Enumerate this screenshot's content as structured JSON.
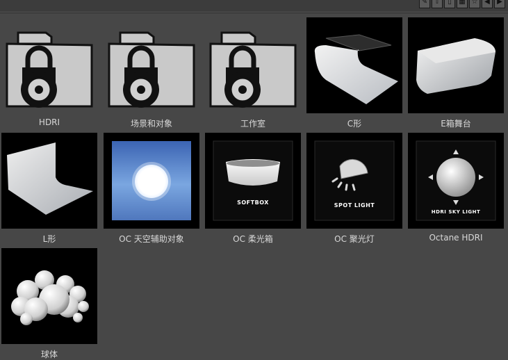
{
  "toolbar": {
    "icons": [
      "edit-icon",
      "upload-icon",
      "clip-icon",
      "grid-icon",
      "star-icon",
      "arrow-left-icon",
      "arrow-right-icon"
    ]
  },
  "items": [
    {
      "label": "HDRI",
      "icon": "locked-folder-icon"
    },
    {
      "label": "场景和对象",
      "icon": "locked-folder-icon"
    },
    {
      "label": "工作室",
      "icon": "locked-folder-icon"
    },
    {
      "label": "C形",
      "icon": "c-shape-backdrop-icon"
    },
    {
      "label": "E箱舞台",
      "icon": "e-box-stage-icon"
    },
    {
      "label": "L形",
      "icon": "l-shape-backdrop-icon"
    },
    {
      "label": "OC 天空辅助对象",
      "icon": "sky-helper-icon"
    },
    {
      "label": "OC 柔光箱",
      "icon": "softbox-icon",
      "caption": "SOFTBOX"
    },
    {
      "label": "OC 聚光灯",
      "icon": "spotlight-icon",
      "caption": "SPOT LIGHT"
    },
    {
      "label": "Octane HDRI",
      "icon": "hdri-sky-light-icon",
      "caption": "HDRI SKY LIGHT"
    },
    {
      "label": "球体",
      "icon": "spheres-icon"
    }
  ]
}
